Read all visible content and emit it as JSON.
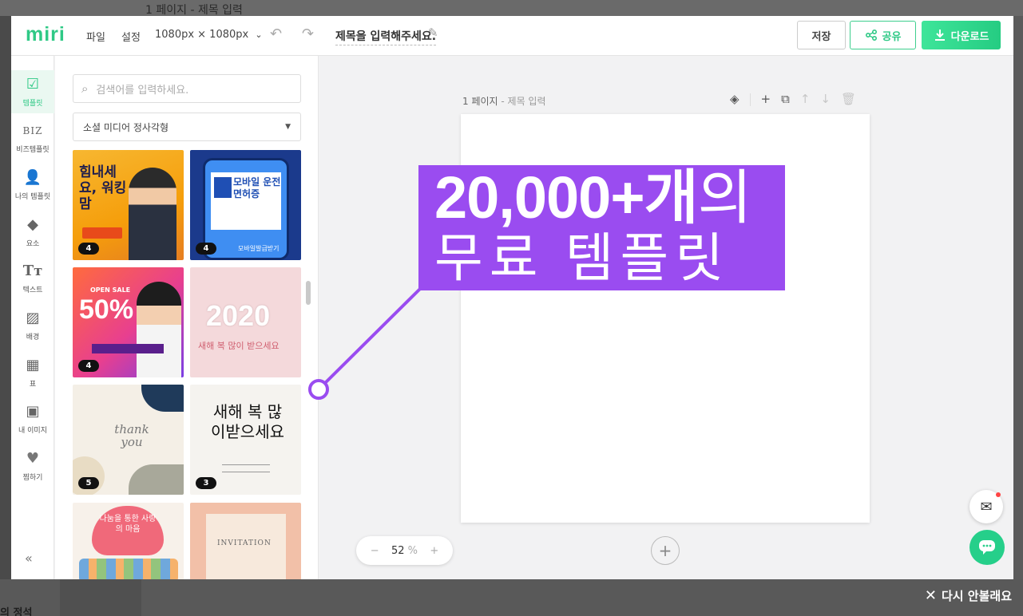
{
  "background": {
    "top_text": "1 페이지 - 제목 입력",
    "bottom_text": "의 정석"
  },
  "dismiss": {
    "label": "다시 안볼래요",
    "icon": "close-icon"
  },
  "topbar": {
    "logo": "miri",
    "menu_file": "파일",
    "menu_settings": "설정",
    "canvas_size": "1080px × 1080px",
    "title_placeholder": "제목을 입력해주세요.",
    "save_label": "저장",
    "share_label": "공유",
    "download_label": "다운로드"
  },
  "rail": {
    "items": [
      {
        "label": "템플릿",
        "icon": "template-icon",
        "active": true
      },
      {
        "label": "비즈템플릿",
        "icon": "biz-icon"
      },
      {
        "label": "나의 템플릿",
        "icon": "my-template-icon"
      },
      {
        "label": "요소",
        "icon": "elements-icon"
      },
      {
        "label": "텍스트",
        "icon": "text-icon"
      },
      {
        "label": "배경",
        "icon": "background-icon"
      },
      {
        "label": "표",
        "icon": "table-icon"
      },
      {
        "label": "내 이미지",
        "icon": "image-icon"
      },
      {
        "label": "찜하기",
        "icon": "heart-icon"
      }
    ]
  },
  "panel": {
    "search_placeholder": "검색어를 입력하세요.",
    "category": "소셜 미디어 정사각형",
    "templates": [
      {
        "headline": "힘내세요, 워킹맘",
        "badge": "4"
      },
      {
        "headline": "모바일 운전면허증",
        "footer": "모바일발급받기",
        "badge": "4"
      },
      {
        "tag": "OPEN SALE",
        "headline": "50%",
        "badge": "4"
      },
      {
        "headline": "2020",
        "sub": "새해 복 많이 받으세요"
      },
      {
        "headline": "thank you",
        "badge": "5"
      },
      {
        "headline": "새해 복 많이받으세요",
        "badge": "3"
      },
      {
        "headline": "나눔을 통한 사랑의 마음"
      },
      {
        "headline": "INVITATION"
      }
    ]
  },
  "canvas": {
    "page_label": "1 페이지",
    "page_sub": " - 제목 입력",
    "zoom_value": "52",
    "zoom_unit": "%"
  },
  "promo": {
    "line1_bold": "20,000+개",
    "line1_light": "의",
    "line2": "무료 템플릿",
    "color": "#9a4cf0"
  }
}
